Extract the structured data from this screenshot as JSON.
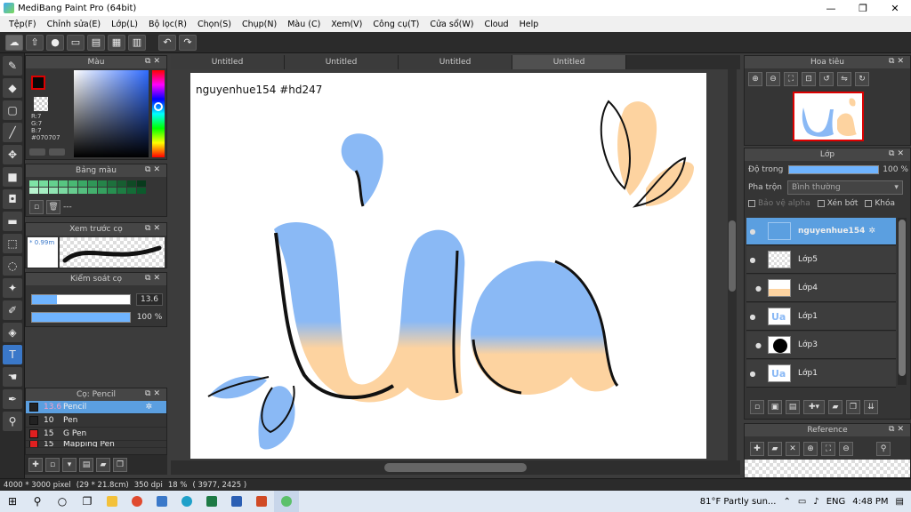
{
  "window": {
    "title": "MediBang Paint Pro (64bit)",
    "minimize": "—",
    "maximize": "❐",
    "close": "✕"
  },
  "menu": [
    "Tệp(F)",
    "Chỉnh sửa(E)",
    "Lớp(L)",
    "Bộ lọc(R)",
    "Chọn(S)",
    "Chụp(N)",
    "Màu (C)",
    "Xem(V)",
    "Công cụ(T)",
    "Cửa sổ(W)",
    "Cloud",
    "Help"
  ],
  "panels": {
    "color": {
      "title": "Màu",
      "rgb": [
        "R:7",
        "G:7",
        "B:7",
        "#070707"
      ]
    },
    "palette": {
      "title": "Bảng màu",
      "colors": [
        "#7fe3a6",
        "#74dc9c",
        "#64d08e",
        "#57c581",
        "#49b873",
        "#3aa865",
        "#2f9657",
        "#258449",
        "#1d703c",
        "#175e31",
        "#0f4a25",
        "#083a1c",
        "#b8f3cf",
        "#a6eec2",
        "#90e4b2",
        "#7bd9a1",
        "#67cc8f",
        "#55bf7f",
        "#44b06e",
        "#35a05f",
        "#278f50",
        "#1d7d43",
        "#146c37",
        "#0c5a2c"
      ],
      "current": "---"
    },
    "preview": {
      "title": "Xem trước cọ",
      "size": "0.99m"
    },
    "brush_control": {
      "title": "Kiểm soát cọ",
      "size": "13.6",
      "size_fraction": 0.25,
      "opacity": "100 %",
      "opacity_fraction": 1.0
    },
    "brushes": {
      "title": "Cọ: Pencil",
      "items": [
        {
          "size": "13.6",
          "name": "Pencil",
          "color": "#222222",
          "selected": true
        },
        {
          "size": "10",
          "name": "Pen",
          "color": "#222222",
          "selected": false
        },
        {
          "size": "15",
          "name": "G Pen",
          "color": "#e02020",
          "selected": false
        },
        {
          "size": "15",
          "name": "Mapping Pen",
          "color": "#e02020",
          "selected": false
        }
      ]
    },
    "navigator": {
      "title": "Hoa tiêu"
    },
    "layers": {
      "title": "Lớp",
      "opacity_label": "Độ trong",
      "opacity_value": "100 %",
      "blend_label": "Pha trộn",
      "blend_value": "Bình thường",
      "protect_alpha": "Bảo vệ alpha",
      "clipping": "Xén bớt",
      "lock": "Khóa",
      "items": [
        {
          "name": "nguyenhue154",
          "selected": true
        },
        {
          "name": "Lớp5",
          "selected": false
        },
        {
          "name": "Lớp4",
          "selected": false
        },
        {
          "name": "Lớp1",
          "selected": false
        },
        {
          "name": "Lớp3",
          "selected": false
        },
        {
          "name": "Lớp1",
          "selected": false
        }
      ]
    },
    "reference": {
      "title": "Reference"
    }
  },
  "tabs": [
    "Untitled",
    "Untitled",
    "Untitled",
    "Untitled"
  ],
  "canvas": {
    "watermark": "nguyenhue154 #hd247"
  },
  "status": {
    "size": "4000 * 3000 pixel",
    "cm": "(29 * 21.8cm)",
    "dpi": "350 dpi",
    "zoom": "18 %",
    "coords": "( 3977, 2425 )"
  },
  "taskbar": {
    "weather": "81°F  Partly sun...",
    "lang": "ENG",
    "time": "4:48 PM"
  },
  "colors": {
    "accent": "#5b9fe0",
    "blue_fill": "#8ab9f5",
    "peach_fill": "#fdd3a0"
  }
}
